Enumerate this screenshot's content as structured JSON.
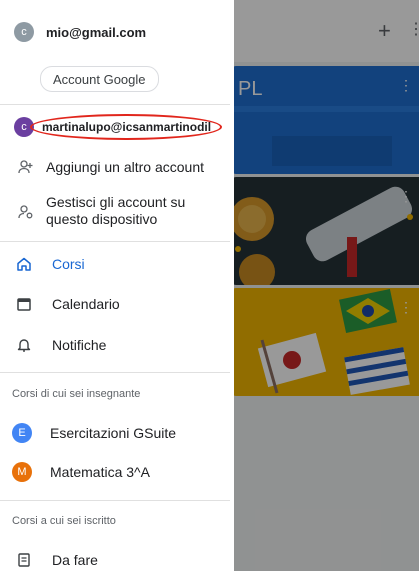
{
  "background": {
    "add_symbol": "+",
    "more_symbol": "⋮",
    "card1_text": "PL"
  },
  "drawer": {
    "primary_account": {
      "avatar_letter": "c",
      "email": "mio@gmail.com"
    },
    "account_button": "Account Google",
    "secondary_account": {
      "avatar_letter": "c",
      "email": "martinalupo@icsanmartinodil"
    },
    "menu": {
      "add_account": "Aggiungi un altro account",
      "manage_accounts": "Gestisci gli account su questo dispositivo",
      "courses": "Corsi",
      "calendar": "Calendario",
      "notifications": "Notifiche"
    },
    "teaching_section": {
      "title": "Corsi di cui sei insegnante",
      "items": [
        {
          "avatar_letter": "E",
          "label": "Esercitazioni GSuite",
          "color": "#4285f4"
        },
        {
          "avatar_letter": "M",
          "label": "Matematica 3^A",
          "color": "#e8710a"
        }
      ]
    },
    "enrolled_section": {
      "title": "Corsi a cui sei iscritto",
      "todo": "Da fare"
    }
  },
  "colors": {
    "accent": "#1967d2",
    "highlight_oval": "#e1261c"
  }
}
